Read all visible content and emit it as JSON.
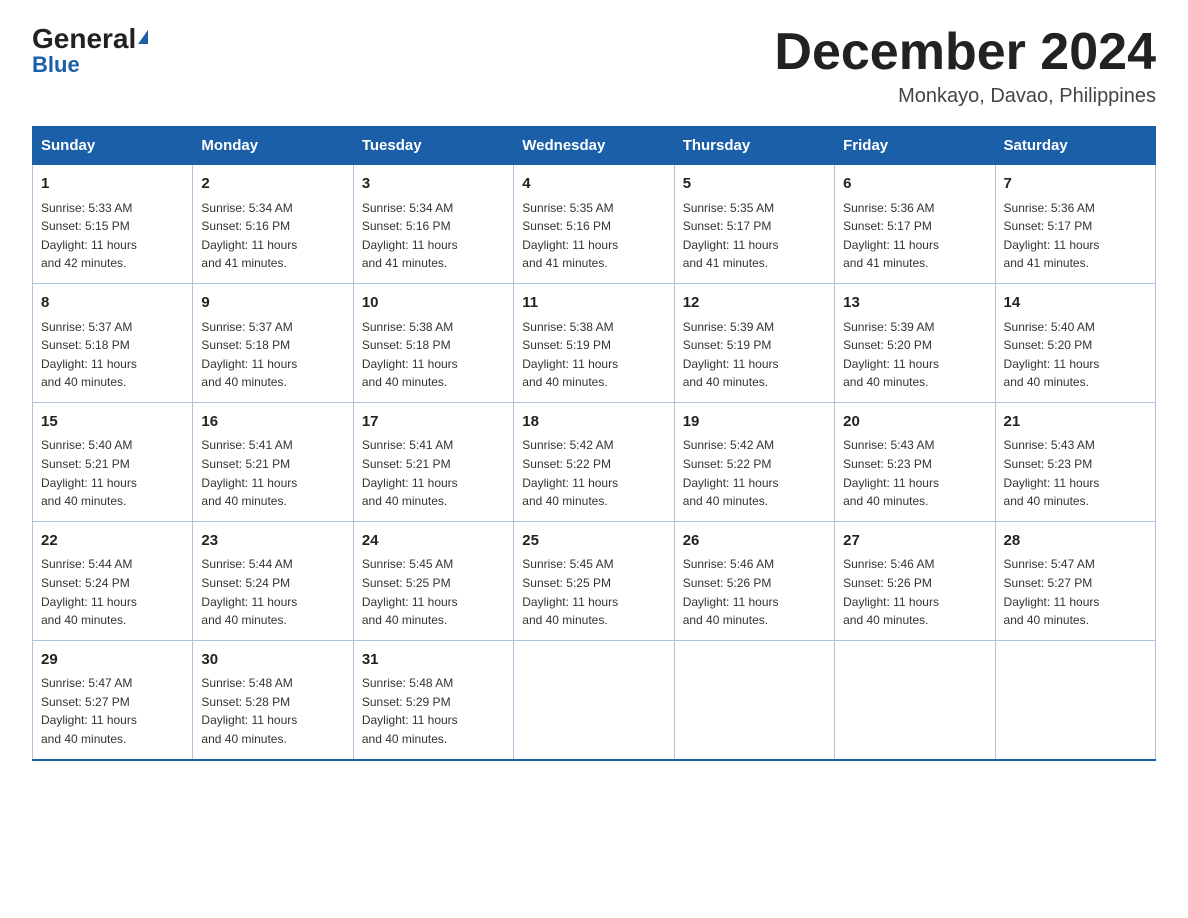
{
  "header": {
    "logo_top": "General",
    "logo_triangle": "▲",
    "logo_bottom": "Blue",
    "month_title": "December 2024",
    "subtitle": "Monkayo, Davao, Philippines"
  },
  "days_of_week": [
    "Sunday",
    "Monday",
    "Tuesday",
    "Wednesday",
    "Thursday",
    "Friday",
    "Saturday"
  ],
  "weeks": [
    [
      {
        "day": "1",
        "sunrise": "5:33 AM",
        "sunset": "5:15 PM",
        "daylight": "11 hours and 42 minutes."
      },
      {
        "day": "2",
        "sunrise": "5:34 AM",
        "sunset": "5:16 PM",
        "daylight": "11 hours and 41 minutes."
      },
      {
        "day": "3",
        "sunrise": "5:34 AM",
        "sunset": "5:16 PM",
        "daylight": "11 hours and 41 minutes."
      },
      {
        "day": "4",
        "sunrise": "5:35 AM",
        "sunset": "5:16 PM",
        "daylight": "11 hours and 41 minutes."
      },
      {
        "day": "5",
        "sunrise": "5:35 AM",
        "sunset": "5:17 PM",
        "daylight": "11 hours and 41 minutes."
      },
      {
        "day": "6",
        "sunrise": "5:36 AM",
        "sunset": "5:17 PM",
        "daylight": "11 hours and 41 minutes."
      },
      {
        "day": "7",
        "sunrise": "5:36 AM",
        "sunset": "5:17 PM",
        "daylight": "11 hours and 41 minutes."
      }
    ],
    [
      {
        "day": "8",
        "sunrise": "5:37 AM",
        "sunset": "5:18 PM",
        "daylight": "11 hours and 40 minutes."
      },
      {
        "day": "9",
        "sunrise": "5:37 AM",
        "sunset": "5:18 PM",
        "daylight": "11 hours and 40 minutes."
      },
      {
        "day": "10",
        "sunrise": "5:38 AM",
        "sunset": "5:18 PM",
        "daylight": "11 hours and 40 minutes."
      },
      {
        "day": "11",
        "sunrise": "5:38 AM",
        "sunset": "5:19 PM",
        "daylight": "11 hours and 40 minutes."
      },
      {
        "day": "12",
        "sunrise": "5:39 AM",
        "sunset": "5:19 PM",
        "daylight": "11 hours and 40 minutes."
      },
      {
        "day": "13",
        "sunrise": "5:39 AM",
        "sunset": "5:20 PM",
        "daylight": "11 hours and 40 minutes."
      },
      {
        "day": "14",
        "sunrise": "5:40 AM",
        "sunset": "5:20 PM",
        "daylight": "11 hours and 40 minutes."
      }
    ],
    [
      {
        "day": "15",
        "sunrise": "5:40 AM",
        "sunset": "5:21 PM",
        "daylight": "11 hours and 40 minutes."
      },
      {
        "day": "16",
        "sunrise": "5:41 AM",
        "sunset": "5:21 PM",
        "daylight": "11 hours and 40 minutes."
      },
      {
        "day": "17",
        "sunrise": "5:41 AM",
        "sunset": "5:21 PM",
        "daylight": "11 hours and 40 minutes."
      },
      {
        "day": "18",
        "sunrise": "5:42 AM",
        "sunset": "5:22 PM",
        "daylight": "11 hours and 40 minutes."
      },
      {
        "day": "19",
        "sunrise": "5:42 AM",
        "sunset": "5:22 PM",
        "daylight": "11 hours and 40 minutes."
      },
      {
        "day": "20",
        "sunrise": "5:43 AM",
        "sunset": "5:23 PM",
        "daylight": "11 hours and 40 minutes."
      },
      {
        "day": "21",
        "sunrise": "5:43 AM",
        "sunset": "5:23 PM",
        "daylight": "11 hours and 40 minutes."
      }
    ],
    [
      {
        "day": "22",
        "sunrise": "5:44 AM",
        "sunset": "5:24 PM",
        "daylight": "11 hours and 40 minutes."
      },
      {
        "day": "23",
        "sunrise": "5:44 AM",
        "sunset": "5:24 PM",
        "daylight": "11 hours and 40 minutes."
      },
      {
        "day": "24",
        "sunrise": "5:45 AM",
        "sunset": "5:25 PM",
        "daylight": "11 hours and 40 minutes."
      },
      {
        "day": "25",
        "sunrise": "5:45 AM",
        "sunset": "5:25 PM",
        "daylight": "11 hours and 40 minutes."
      },
      {
        "day": "26",
        "sunrise": "5:46 AM",
        "sunset": "5:26 PM",
        "daylight": "11 hours and 40 minutes."
      },
      {
        "day": "27",
        "sunrise": "5:46 AM",
        "sunset": "5:26 PM",
        "daylight": "11 hours and 40 minutes."
      },
      {
        "day": "28",
        "sunrise": "5:47 AM",
        "sunset": "5:27 PM",
        "daylight": "11 hours and 40 minutes."
      }
    ],
    [
      {
        "day": "29",
        "sunrise": "5:47 AM",
        "sunset": "5:27 PM",
        "daylight": "11 hours and 40 minutes."
      },
      {
        "day": "30",
        "sunrise": "5:48 AM",
        "sunset": "5:28 PM",
        "daylight": "11 hours and 40 minutes."
      },
      {
        "day": "31",
        "sunrise": "5:48 AM",
        "sunset": "5:29 PM",
        "daylight": "11 hours and 40 minutes."
      },
      null,
      null,
      null,
      null
    ]
  ],
  "labels": {
    "sunrise": "Sunrise:",
    "sunset": "Sunset:",
    "daylight": "Daylight:"
  }
}
